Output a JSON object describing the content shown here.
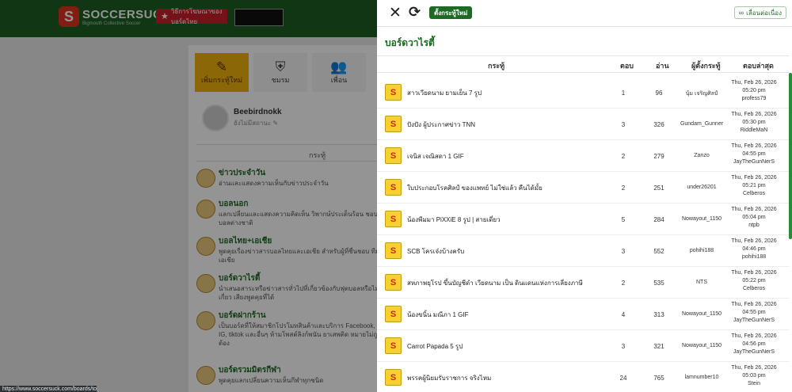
{
  "background": {
    "logo": {
      "name": "SOCCERSUCK",
      "tagline": "Bigmouth Collective Soccer"
    },
    "header": {
      "promo_label": "วิธีการโฆษณาของบอร์ดไทย",
      "banner_label": ""
    },
    "tabs": [
      {
        "label": "เพิ่มกระทู้ใหม่",
        "icon": "new-post-icon"
      },
      {
        "label": "ชมรม",
        "icon": "club-icon"
      },
      {
        "label": "เพื่อน",
        "icon": "friends-icon"
      }
    ],
    "user": {
      "name": "Beebirdnokk",
      "status": "ยังไม่มีสถานะ"
    },
    "column_header": "กระทู้",
    "forums": [
      {
        "title": "ข่าวประจำวัน",
        "desc": "อ่านและแสดงความเห็นกับข่าวประจำวัน"
      },
      {
        "title": "บอลนอก",
        "desc": "แลกเปลี่ยนและแสดงความคิดเห็น วิพากษ์ประเด็นร้อน ชอบไร้ บอลต่างชาติ"
      },
      {
        "title": "บอลไทย+เอเชีย",
        "desc": "พูดคุยเรื่องข่าวสารบอลไทยและเอเชีย สำหรับผู้ที่ชื่นชอบ ทีมเอเชีย"
      },
      {
        "title": "บอร์ดวาไรตี้",
        "desc": "นำเสนอสาระหรือข่าวสารทั่วไปที่เกี่ยวข้องกับฟุตบอลหรือไม่เกี่ยว เสียงพูดคุยที่ได้"
      },
      {
        "title": "บอร์ดฝากร้าน",
        "desc": "เป็นบอร์ดที่ให้สมาชิกโปรโมทสินค้าและบริการ Facebook, IG, tiktok และอื่นๆ ห้ามโพสต์ลิงก์พนัน ยาเสพติด หมายไม่ถูกต้อง"
      },
      {
        "title": "บอร์ดรวมมิตรกีฬา",
        "desc": "พูดคุยแลกเปลี่ยนความเห็นกีฬาทุกชนิด"
      }
    ],
    "status_url": "https://www.soccersuck.com/boards/topic/2646108"
  },
  "drawer": {
    "new_topic_label": "ตั้งกระทู้ใหม่",
    "follow_label": "เลื่อนต่อเนื่อง",
    "board_title": "บอร์ดวาไรตี้",
    "columns": {
      "topic": "กระทู้",
      "replies": "ตอบ",
      "views": "อ่าน",
      "author": "ผู้ตั้งกระทู้",
      "last": "ตอบล่าสุด"
    },
    "topics": [
      {
        "title": "สาวเวียดนาม ยามเย็น 7 รูป",
        "replies": "1",
        "views": "96",
        "author": "นุ้ม เจริญศิลป์",
        "last_date": "Thu, Feb 26, 2026",
        "last_time": "05:20 pm",
        "last_user": "profess79"
      },
      {
        "title": "ปังปัง ผู้ประกาศข่าว TNN",
        "replies": "3",
        "views": "326",
        "author": "Gundam_Gunner",
        "last_date": "Thu, Feb 26, 2026",
        "last_time": "05:30 pm",
        "last_user": "RiddleMaN"
      },
      {
        "title": "เจนิส เจณิสดา 1 GIF",
        "replies": "2",
        "views": "279",
        "author": "Zanzo",
        "last_date": "Thu, Feb 26, 2026",
        "last_time": "04:55 pm",
        "last_user": "JayTheGunNerS"
      },
      {
        "title": "ใบประกอบโรคศิลป์ ของแพทย์ ไม่ใช่แล้ว คืนได้มั้ย",
        "replies": "2",
        "views": "251",
        "author": "under26201",
        "last_date": "Thu, Feb 26, 2026",
        "last_time": "05:21 pm",
        "last_user": "Celberos"
      },
      {
        "title": "น้องพีมมา PiXXiE 8 รูป | สายเดี่ยว",
        "replies": "5",
        "views": "284",
        "author": "Nowayout_1150",
        "last_date": "Thu, Feb 26, 2026",
        "last_time": "05:04 pm",
        "last_user": "ntpb"
      },
      {
        "title": "SCB โครเจ๋งบ้างครับ",
        "replies": "3",
        "views": "552",
        "author": "pohihi188",
        "last_date": "Thu, Feb 26, 2026",
        "last_time": "04:46 pm",
        "last_user": "pohihi188"
      },
      {
        "title": "สหภาพยุโรป ขึ้นบัญชีดำ เวียดนาม เป็น ดินแดนแห่งการเลี่ยงภาษี",
        "replies": "2",
        "views": "535",
        "author": "NTS",
        "last_date": "Thu, Feb 26, 2026",
        "last_time": "05:22 pm",
        "last_user": "Celberos"
      },
      {
        "title": "น้องขนิ้น มณีภา 1 GIF",
        "replies": "4",
        "views": "313",
        "author": "Nowayout_1150",
        "last_date": "Thu, Feb 26, 2026",
        "last_time": "04:55 pm",
        "last_user": "JayTheGunNerS"
      },
      {
        "title": "Carrot Papada 5 รูป",
        "replies": "3",
        "views": "321",
        "author": "Nowayout_1150",
        "last_date": "Thu, Feb 26, 2026",
        "last_time": "04:56 pm",
        "last_user": "JayTheGunNerS"
      },
      {
        "title": "พรรคผู้นิยมรับราชการ จริงไหม",
        "replies": "24",
        "views": "765",
        "author": "lamnumber10",
        "last_date": "Thu, Feb 26, 2026",
        "last_time": "05:03 pm",
        "last_user": "Stein"
      }
    ]
  }
}
